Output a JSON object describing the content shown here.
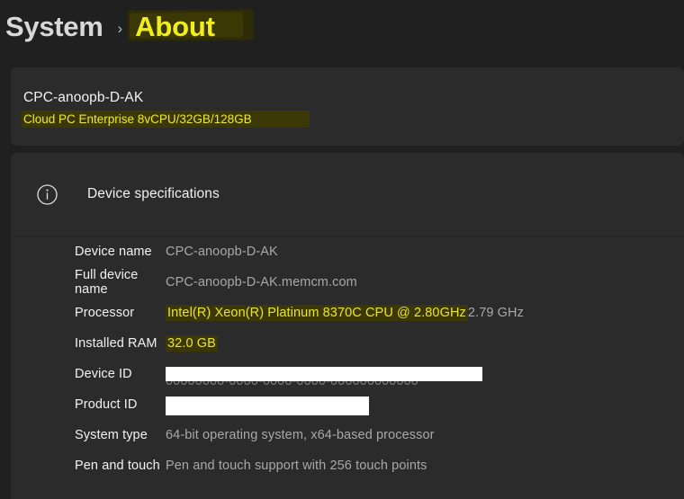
{
  "breadcrumb": {
    "parent": "System",
    "separator": "›",
    "current": "About"
  },
  "device_card": {
    "name": "CPC-anoopb-D-AK",
    "subtitle": "Cloud PC Enterprise 8vCPU/32GB/128GB"
  },
  "specs_section": {
    "icon": "info-circle-icon",
    "title": "Device specifications",
    "rows": [
      {
        "label": "Device name",
        "value": "CPC-anoopb-D-AK",
        "highlight": false,
        "redacted": false
      },
      {
        "label": "Full device name",
        "value": "CPC-anoopb-D-AK.memcm.com",
        "highlight": false,
        "redacted": false
      },
      {
        "label": "Processor",
        "value": "Intel(R) Xeon(R) Platinum 8370C CPU @ 2.80GHz",
        "value_tail": "2.79 GHz",
        "highlight": true,
        "redacted": false
      },
      {
        "label": "Installed RAM",
        "value": "32.0 GB",
        "highlight": true,
        "redacted": false
      },
      {
        "label": "Device ID",
        "value": "",
        "highlight": false,
        "redacted": true
      },
      {
        "label": "Product ID",
        "value": "",
        "highlight": false,
        "redacted": true
      },
      {
        "label": "System type",
        "value": "64-bit operating system, x64-based processor",
        "highlight": false,
        "redacted": false
      },
      {
        "label": "Pen and touch",
        "value": "Pen and touch support with 256 touch points",
        "highlight": false,
        "redacted": false
      }
    ]
  },
  "colors": {
    "page_bg": "#202020",
    "card_bg": "#2b2b2b",
    "highlight_bg": "#3b3806",
    "highlight_text": "#e9e52a",
    "value_text": "#a8a8a8",
    "label_text": "#f2f2f2",
    "redaction": "#ffffff"
  }
}
